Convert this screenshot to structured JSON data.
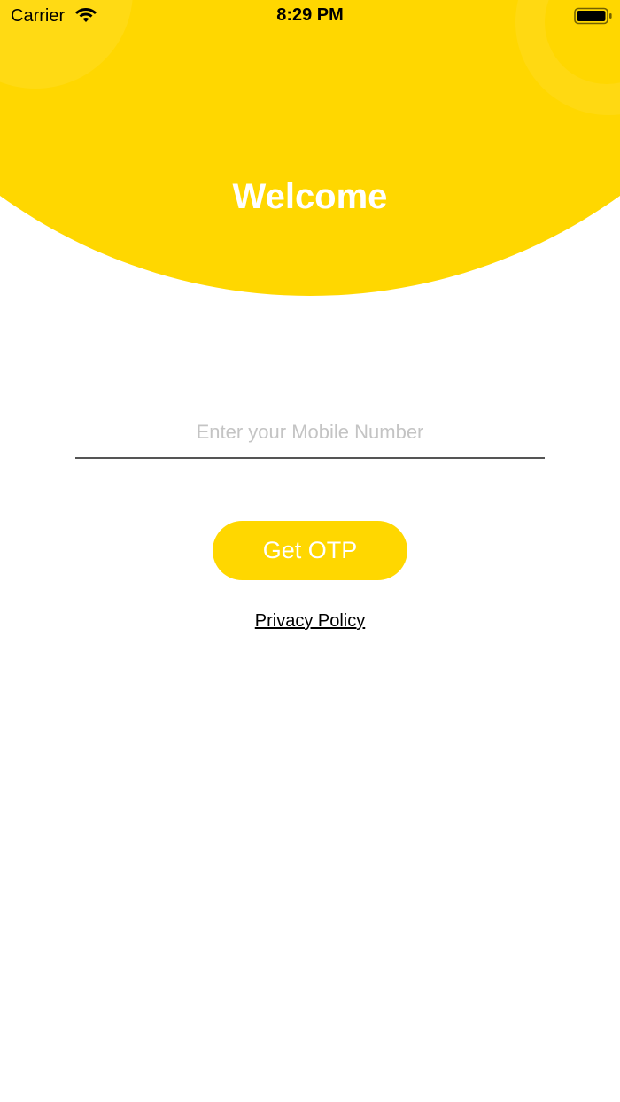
{
  "status_bar": {
    "carrier": "Carrier",
    "time": "8:29 PM",
    "wifi_icon": "wifi-icon",
    "battery_icon": "battery-icon"
  },
  "header": {
    "title": "Welcome"
  },
  "form": {
    "mobile_placeholder": "Enter your Mobile Number",
    "mobile_value": "",
    "otp_button_label": "Get OTP",
    "privacy_link_label": "Privacy Policy"
  },
  "colors": {
    "accent": "#FFD700",
    "background": "#FFFFFF",
    "placeholder": "#C4C4C4",
    "underline": "#555555"
  }
}
